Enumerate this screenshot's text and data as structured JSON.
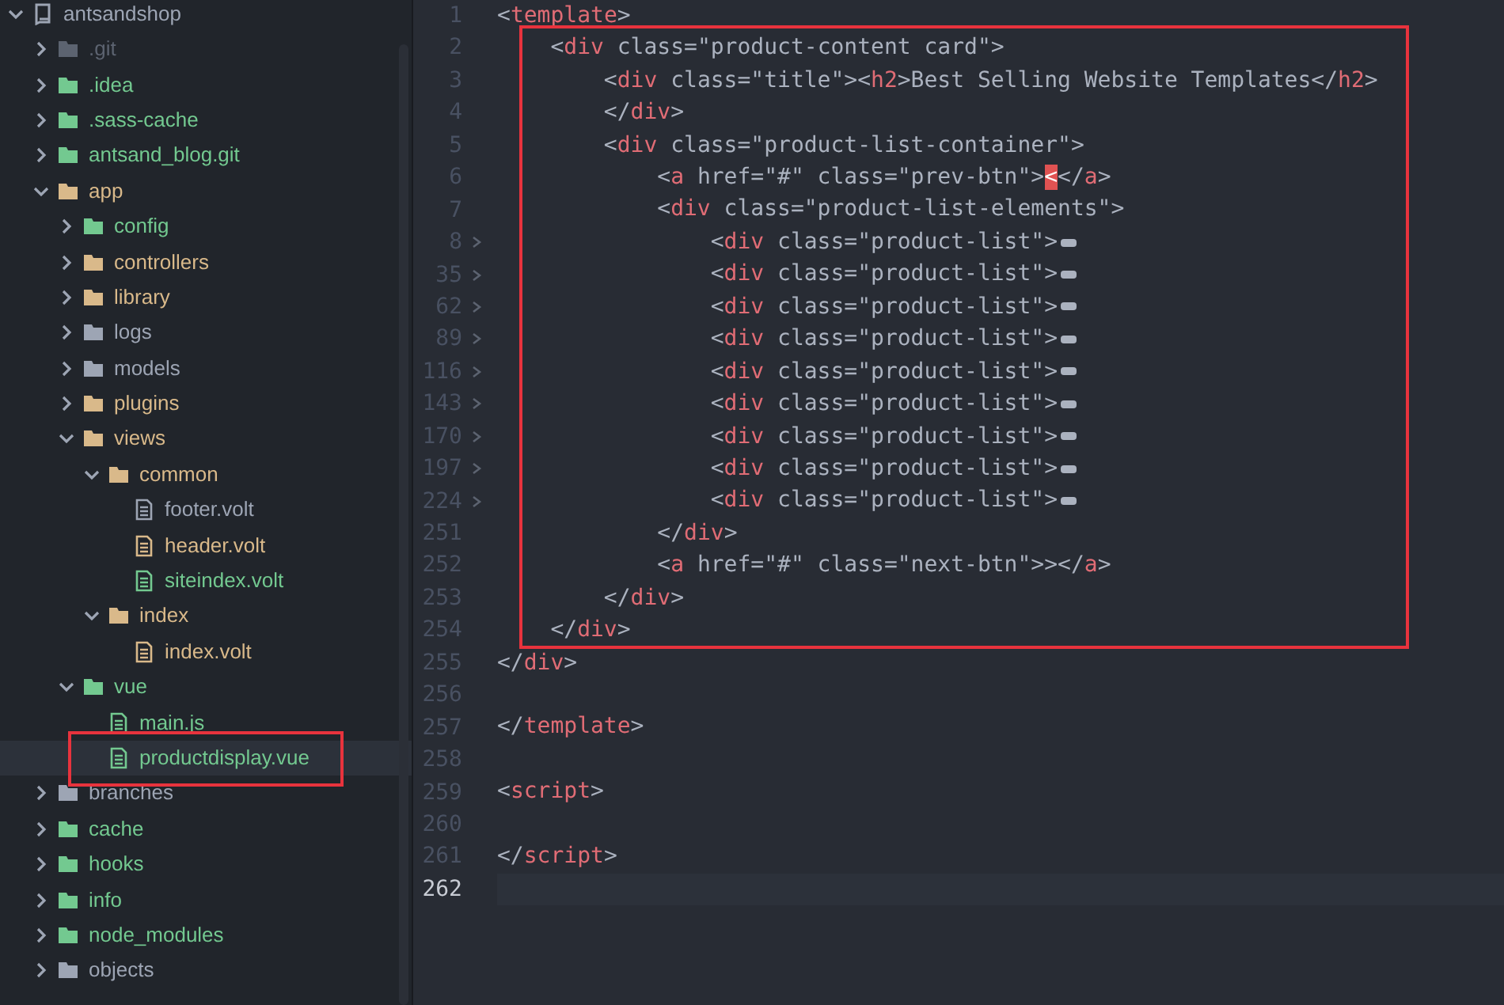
{
  "tree": {
    "label": "antsandshop",
    "kind": "repo",
    "expanded": true,
    "color": "#9da5b4",
    "children": [
      {
        "label": ".git",
        "kind": "folder",
        "expanded": false,
        "selected": false,
        "boxed": false,
        "color": "#5c6370"
      },
      {
        "label": ".idea",
        "kind": "folder",
        "expanded": false,
        "selected": false,
        "boxed": false,
        "color": "#73c990"
      },
      {
        "label": ".sass-cache",
        "kind": "folder",
        "expanded": false,
        "selected": false,
        "boxed": false,
        "color": "#73c990"
      },
      {
        "label": "antsand_blog.git",
        "kind": "folder",
        "expanded": false,
        "selected": false,
        "boxed": false,
        "color": "#73c990"
      },
      {
        "label": "app",
        "kind": "folder",
        "expanded": true,
        "selected": false,
        "boxed": false,
        "color": "#d9b98a",
        "children": [
          {
            "label": "config",
            "kind": "folder",
            "expanded": false,
            "selected": false,
            "boxed": false,
            "color": "#73c990"
          },
          {
            "label": "controllers",
            "kind": "folder",
            "expanded": false,
            "selected": false,
            "boxed": false,
            "color": "#d9b98a"
          },
          {
            "label": "library",
            "kind": "folder",
            "expanded": false,
            "selected": false,
            "boxed": false,
            "color": "#d9b98a"
          },
          {
            "label": "logs",
            "kind": "folder",
            "expanded": false,
            "selected": false,
            "boxed": false,
            "color": "#9da5b4"
          },
          {
            "label": "models",
            "kind": "folder",
            "expanded": false,
            "selected": false,
            "boxed": false,
            "color": "#9da5b4"
          },
          {
            "label": "plugins",
            "kind": "folder",
            "expanded": false,
            "selected": false,
            "boxed": false,
            "color": "#d9b98a"
          },
          {
            "label": "views",
            "kind": "folder",
            "expanded": true,
            "selected": false,
            "boxed": false,
            "color": "#d9b98a",
            "children": [
              {
                "label": "common",
                "kind": "folder",
                "expanded": true,
                "selected": false,
                "boxed": false,
                "color": "#d9b98a",
                "children": [
                  {
                    "label": "footer.volt",
                    "kind": "file",
                    "selected": false,
                    "boxed": false,
                    "color": "#9da5b4"
                  },
                  {
                    "label": "header.volt",
                    "kind": "file",
                    "selected": false,
                    "boxed": false,
                    "color": "#d9b98a"
                  },
                  {
                    "label": "siteindex.volt",
                    "kind": "file",
                    "selected": false,
                    "boxed": false,
                    "color": "#73c990"
                  }
                ]
              },
              {
                "label": "index",
                "kind": "folder",
                "expanded": true,
                "selected": false,
                "boxed": false,
                "color": "#d9b98a",
                "children": [
                  {
                    "label": "index.volt",
                    "kind": "file",
                    "selected": false,
                    "boxed": false,
                    "color": "#d9b98a"
                  }
                ]
              }
            ]
          },
          {
            "label": "vue",
            "kind": "folder",
            "expanded": true,
            "selected": false,
            "boxed": false,
            "color": "#73c990",
            "children": [
              {
                "label": "main.js",
                "kind": "file",
                "selected": false,
                "boxed": false,
                "color": "#73c990"
              },
              {
                "label": "productdisplay.vue",
                "kind": "file",
                "selected": true,
                "boxed": true,
                "color": "#73c990"
              }
            ]
          }
        ]
      },
      {
        "label": "branches",
        "kind": "folder",
        "expanded": false,
        "selected": false,
        "boxed": false,
        "color": "#9da5b4"
      },
      {
        "label": "cache",
        "kind": "folder",
        "expanded": false,
        "selected": false,
        "boxed": false,
        "color": "#73c990"
      },
      {
        "label": "hooks",
        "kind": "folder",
        "expanded": false,
        "selected": false,
        "boxed": false,
        "color": "#73c990"
      },
      {
        "label": "info",
        "kind": "folder",
        "expanded": false,
        "selected": false,
        "boxed": false,
        "color": "#73c990"
      },
      {
        "label": "node_modules",
        "kind": "folder",
        "expanded": false,
        "selected": false,
        "boxed": false,
        "color": "#73c990"
      },
      {
        "label": "objects",
        "kind": "folder",
        "expanded": false,
        "selected": false,
        "boxed": false,
        "color": "#9da5b4"
      }
    ]
  },
  "editor": {
    "blocks": [
      {
        "kind": "plain",
        "lines": [
          {
            "number": "1",
            "folded": false,
            "current": false,
            "tokens": [
              {
                "kind": "plain",
                "text": "<"
              },
              {
                "kind": "tag",
                "text": "template"
              },
              {
                "kind": "plain",
                "text": ">"
              }
            ]
          }
        ]
      },
      {
        "kind": "boxed",
        "lines": [
          {
            "number": "2",
            "folded": false,
            "current": false,
            "tokens": [
              {
                "kind": "plain",
                "text": "    <"
              },
              {
                "kind": "tag",
                "text": "div"
              },
              {
                "kind": "plain",
                "text": " class=\"product-content card\">"
              }
            ]
          },
          {
            "number": "3",
            "folded": false,
            "current": false,
            "tokens": [
              {
                "kind": "plain",
                "text": "        <"
              },
              {
                "kind": "tag",
                "text": "div"
              },
              {
                "kind": "plain",
                "text": " class=\"title\"><"
              },
              {
                "kind": "tag",
                "text": "h2"
              },
              {
                "kind": "plain",
                "text": ">Best Selling Website Templates</"
              },
              {
                "kind": "tag",
                "text": "h2"
              },
              {
                "kind": "plain",
                "text": ">"
              }
            ]
          },
          {
            "number": "4",
            "folded": false,
            "current": false,
            "tokens": [
              {
                "kind": "plain",
                "text": "        </"
              },
              {
                "kind": "tag",
                "text": "div"
              },
              {
                "kind": "plain",
                "text": ">"
              }
            ]
          },
          {
            "number": "5",
            "folded": false,
            "current": false,
            "tokens": [
              {
                "kind": "plain",
                "text": "        <"
              },
              {
                "kind": "tag",
                "text": "div"
              },
              {
                "kind": "plain",
                "text": " class=\"product-list-container\">"
              }
            ]
          },
          {
            "number": "6",
            "folded": false,
            "current": false,
            "tokens": [
              {
                "kind": "plain",
                "text": "            <"
              },
              {
                "kind": "tag",
                "text": "a"
              },
              {
                "kind": "plain",
                "text": " href=\"#\" class=\"prev-btn\">"
              },
              {
                "kind": "match",
                "text": "<"
              },
              {
                "kind": "plain",
                "text": "</"
              },
              {
                "kind": "tag",
                "text": "a"
              },
              {
                "kind": "plain",
                "text": ">"
              }
            ]
          },
          {
            "number": "7",
            "folded": false,
            "current": false,
            "tokens": [
              {
                "kind": "plain",
                "text": "            <"
              },
              {
                "kind": "tag",
                "text": "div"
              },
              {
                "kind": "plain",
                "text": " class=\"product-list-elements\">"
              }
            ]
          },
          {
            "number": "8",
            "folded": true,
            "current": false,
            "tokens": [
              {
                "kind": "plain",
                "text": "                <"
              },
              {
                "kind": "tag",
                "text": "div"
              },
              {
                "kind": "plain",
                "text": " class=\"product-list\">"
              }
            ]
          },
          {
            "number": "35",
            "folded": true,
            "current": false,
            "tokens": [
              {
                "kind": "plain",
                "text": "                <"
              },
              {
                "kind": "tag",
                "text": "div"
              },
              {
                "kind": "plain",
                "text": " class=\"product-list\">"
              }
            ]
          },
          {
            "number": "62",
            "folded": true,
            "current": false,
            "tokens": [
              {
                "kind": "plain",
                "text": "                <"
              },
              {
                "kind": "tag",
                "text": "div"
              },
              {
                "kind": "plain",
                "text": " class=\"product-list\">"
              }
            ]
          },
          {
            "number": "89",
            "folded": true,
            "current": false,
            "tokens": [
              {
                "kind": "plain",
                "text": "                <"
              },
              {
                "kind": "tag",
                "text": "div"
              },
              {
                "kind": "plain",
                "text": " class=\"product-list\">"
              }
            ]
          },
          {
            "number": "116",
            "folded": true,
            "current": false,
            "tokens": [
              {
                "kind": "plain",
                "text": "                <"
              },
              {
                "kind": "tag",
                "text": "div"
              },
              {
                "kind": "plain",
                "text": " class=\"product-list\">"
              }
            ]
          },
          {
            "number": "143",
            "folded": true,
            "current": false,
            "tokens": [
              {
                "kind": "plain",
                "text": "                <"
              },
              {
                "kind": "tag",
                "text": "div"
              },
              {
                "kind": "plain",
                "text": " class=\"product-list\">"
              }
            ]
          },
          {
            "number": "170",
            "folded": true,
            "current": false,
            "tokens": [
              {
                "kind": "plain",
                "text": "                <"
              },
              {
                "kind": "tag",
                "text": "div"
              },
              {
                "kind": "plain",
                "text": " class=\"product-list\">"
              }
            ]
          },
          {
            "number": "197",
            "folded": true,
            "current": false,
            "tokens": [
              {
                "kind": "plain",
                "text": "                <"
              },
              {
                "kind": "tag",
                "text": "div"
              },
              {
                "kind": "plain",
                "text": " class=\"product-list\">"
              }
            ]
          },
          {
            "number": "224",
            "folded": true,
            "current": false,
            "tokens": [
              {
                "kind": "plain",
                "text": "                <"
              },
              {
                "kind": "tag",
                "text": "div"
              },
              {
                "kind": "plain",
                "text": " class=\"product-list\">"
              }
            ]
          },
          {
            "number": "251",
            "folded": false,
            "current": false,
            "tokens": [
              {
                "kind": "plain",
                "text": "            </"
              },
              {
                "kind": "tag",
                "text": "div"
              },
              {
                "kind": "plain",
                "text": ">"
              }
            ]
          },
          {
            "number": "252",
            "folded": false,
            "current": false,
            "tokens": [
              {
                "kind": "plain",
                "text": "            <"
              },
              {
                "kind": "tag",
                "text": "a"
              },
              {
                "kind": "plain",
                "text": " href=\"#\" class=\"next-btn\">></"
              },
              {
                "kind": "tag",
                "text": "a"
              },
              {
                "kind": "plain",
                "text": ">"
              }
            ]
          },
          {
            "number": "253",
            "folded": false,
            "current": false,
            "tokens": [
              {
                "kind": "plain",
                "text": "        </"
              },
              {
                "kind": "tag",
                "text": "div"
              },
              {
                "kind": "plain",
                "text": ">"
              }
            ]
          },
          {
            "number": "254",
            "folded": false,
            "current": false,
            "tokens": [
              {
                "kind": "plain",
                "text": "    </"
              },
              {
                "kind": "tag",
                "text": "div"
              },
              {
                "kind": "plain",
                "text": ">"
              }
            ]
          }
        ]
      },
      {
        "kind": "plain",
        "lines": [
          {
            "number": "255",
            "folded": false,
            "current": false,
            "tokens": [
              {
                "kind": "plain",
                "text": "</"
              },
              {
                "kind": "tag",
                "text": "div"
              },
              {
                "kind": "plain",
                "text": ">"
              }
            ]
          },
          {
            "number": "256",
            "folded": false,
            "current": false
          },
          {
            "number": "257",
            "folded": false,
            "current": false,
            "tokens": [
              {
                "kind": "plain",
                "text": "</"
              },
              {
                "kind": "tag",
                "text": "template"
              },
              {
                "kind": "plain",
                "text": ">"
              }
            ]
          },
          {
            "number": "258",
            "folded": false,
            "current": false
          },
          {
            "number": "259",
            "folded": false,
            "current": false,
            "tokens": [
              {
                "kind": "plain",
                "text": "<"
              },
              {
                "kind": "tag",
                "text": "script"
              },
              {
                "kind": "plain",
                "text": ">"
              }
            ]
          },
          {
            "number": "260",
            "folded": false,
            "current": false
          },
          {
            "number": "261",
            "folded": false,
            "current": false,
            "tokens": [
              {
                "kind": "plain",
                "text": "</"
              },
              {
                "kind": "tag",
                "text": "script"
              },
              {
                "kind": "plain",
                "text": ">"
              }
            ]
          },
          {
            "number": "262",
            "folded": false,
            "current": true
          }
        ]
      }
    ]
  }
}
